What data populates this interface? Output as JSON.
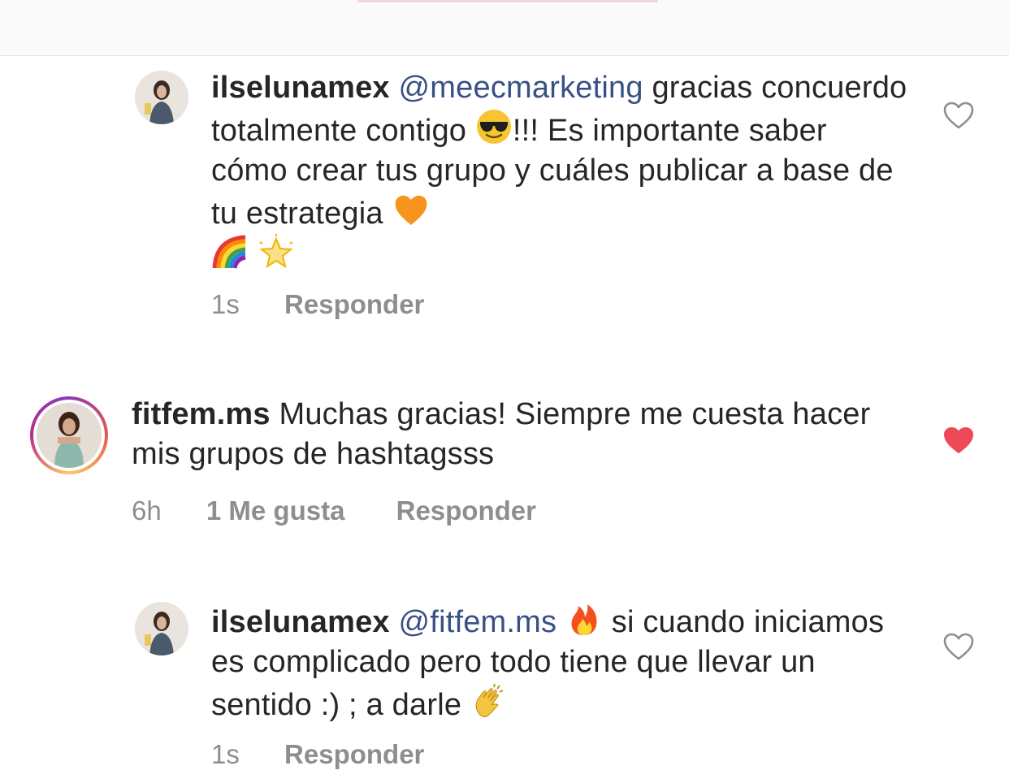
{
  "colors": {
    "text": "#262626",
    "mention": "#385185",
    "meta": "#8e8e8e",
    "heart_liked": "#ed4956",
    "heart_outline": "#8e8e8e"
  },
  "comments": [
    {
      "username": "ilselunamex",
      "mention": "@meecmarketing",
      "text_1": " gracias concuerdo totalmente contigo ",
      "emoji_1": "sunglasses-emoji",
      "text_2": "!!! Es importante saber cómo crear tus grupo y cuáles publicar a base de tu estrategia ",
      "emoji_2": "orange-heart-emoji",
      "emoji_3": "rainbow-emoji",
      "emoji_4": "glowing-star-emoji",
      "time": "1s",
      "reply_label": "Responder",
      "liked": false
    },
    {
      "username": "fitfem.ms",
      "text_1": " Muchas gracias! Siempre me cuesta hacer mis grupos de hashtagsss",
      "time": "6h",
      "likes_label": "1 Me gusta",
      "reply_label": "Responder",
      "liked": true
    },
    {
      "username": "ilselunamex",
      "mention": "@fitfem.ms",
      "emoji_1": "fire-emoji",
      "text_1": " si cuando iniciamos es complicado pero todo tiene que llevar un sentido :) ; a darle ",
      "emoji_2": "clapping-hands-emoji",
      "time": "1s",
      "reply_label": "Responder",
      "liked": false
    }
  ]
}
